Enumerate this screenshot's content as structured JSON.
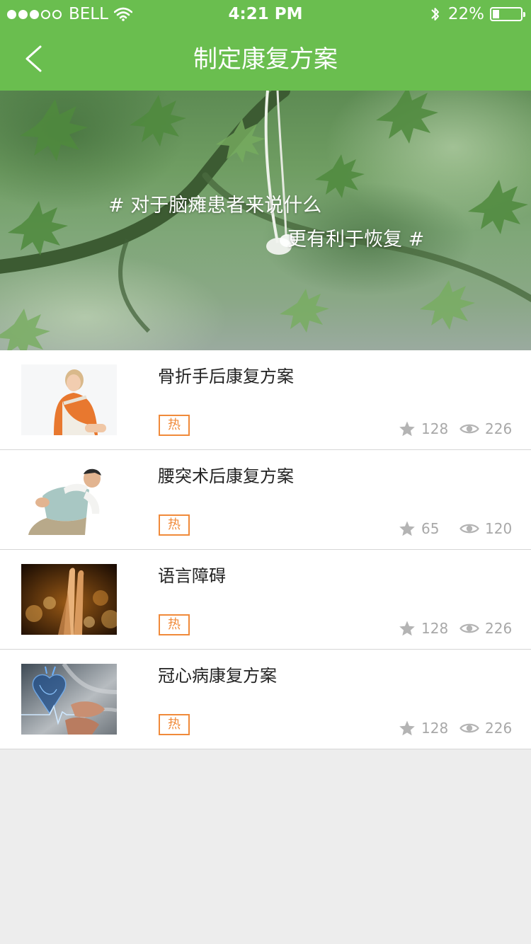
{
  "status_bar": {
    "carrier": "BELL",
    "time": "4:21 PM",
    "battery_percent": "22%",
    "battery_level": 0.22,
    "signal_bars": 3,
    "signal_total": 5
  },
  "nav": {
    "title": "制定康复方案",
    "back_icon": "chevron-left-icon"
  },
  "banner": {
    "line1": "# 对于脑瘫患者来说什么",
    "line2": "更有利于恢复 #"
  },
  "colors": {
    "primary_green": "#6abe4f",
    "hot_orange": "#f08a3a",
    "stat_gray": "#a8a8a8",
    "background": "#ededed"
  },
  "items": [
    {
      "title": "骨折手后康复方案",
      "badge": "热",
      "likes": "128",
      "views": "226",
      "thumb_icon": "arm-sling-photo"
    },
    {
      "title": "腰突术后康复方案",
      "badge": "热",
      "likes": "65",
      "views": "120",
      "thumb_icon": "back-pain-photo"
    },
    {
      "title": "语言障碍",
      "badge": "热",
      "likes": "128",
      "views": "226",
      "thumb_icon": "hands-photo"
    },
    {
      "title": "冠心病康复方案",
      "badge": "热",
      "likes": "128",
      "views": "226",
      "thumb_icon": "heart-photo"
    }
  ]
}
